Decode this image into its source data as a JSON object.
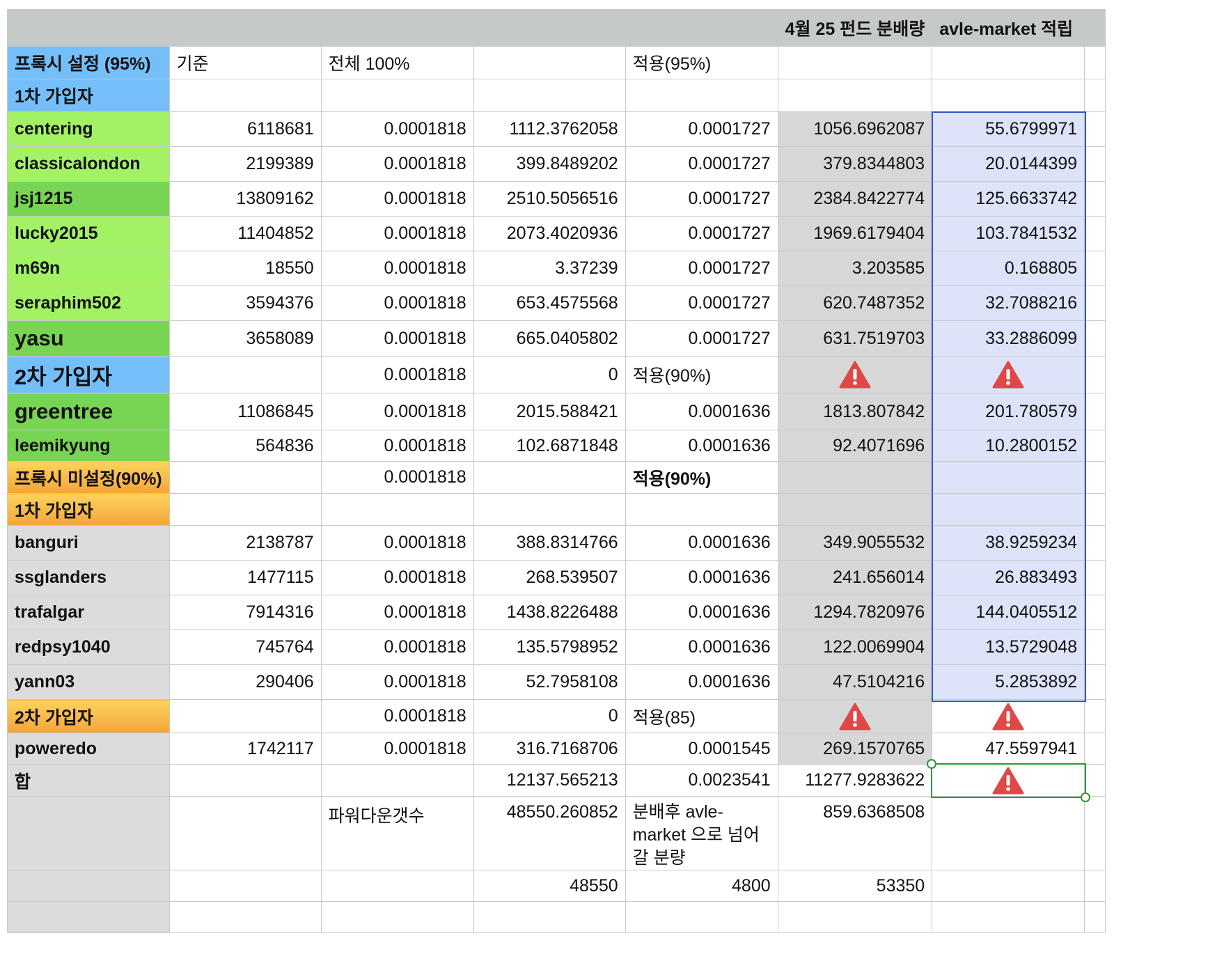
{
  "colors": {
    "header": "#c6c9c9",
    "blue_label": "#74bffa",
    "green_light": "#a3f264",
    "green_dark": "#78d554",
    "orange_label": "#f8b344",
    "gray_label": "#dcdcdc",
    "fund_col": "#d7d7d7",
    "selected_col": "#dde3f8",
    "warning": "#e04848"
  },
  "columns": [
    "",
    "",
    "",
    "",
    "",
    "4월 25 펀드 분배량",
    "avle-market 적립"
  ],
  "rows": [
    {
      "cells": [
        "프록시 설정 (95%)",
        "기준",
        "전체 100%",
        "",
        "적용(95%)",
        "",
        ""
      ]
    },
    {
      "cells": [
        "1차 가입자",
        "",
        "",
        "",
        "",
        "",
        ""
      ]
    },
    {
      "cells": [
        "centering",
        "6118681",
        "0.0001818",
        "1112.3762058",
        "0.0001727",
        "1056.6962087",
        "55.6799971"
      ]
    },
    {
      "cells": [
        "classicalondon",
        "2199389",
        "0.0001818",
        "399.8489202",
        "0.0001727",
        "379.8344803",
        "20.0144399"
      ]
    },
    {
      "cells": [
        "jsj1215",
        "13809162",
        "0.0001818",
        "2510.5056516",
        "0.0001727",
        "2384.8422774",
        "125.6633742"
      ]
    },
    {
      "cells": [
        "lucky2015",
        "11404852",
        "0.0001818",
        "2073.4020936",
        "0.0001727",
        "1969.6179404",
        "103.7841532"
      ]
    },
    {
      "cells": [
        "m69n",
        "18550",
        "0.0001818",
        "3.37239",
        "0.0001727",
        "3.203585",
        "0.168805"
      ]
    },
    {
      "cells": [
        "seraphim502",
        "3594376",
        "0.0001818",
        "653.4575568",
        "0.0001727",
        "620.7487352",
        "32.7088216"
      ]
    },
    {
      "cells": [
        "yasu",
        "3658089",
        "0.0001818",
        "665.0405802",
        "0.0001727",
        "631.7519703",
        "33.2886099"
      ]
    },
    {
      "cells": [
        "2차 가입자",
        "",
        "0.0001818",
        "0",
        "적용(90%)",
        "",
        ""
      ]
    },
    {
      "cells": [
        "greentree",
        "11086845",
        "0.0001818",
        "2015.588421",
        "0.0001636",
        "1813.807842",
        "201.780579"
      ]
    },
    {
      "cells": [
        "leemikyung",
        "564836",
        "0.0001818",
        "102.6871848",
        "0.0001636",
        "92.4071696",
        "10.2800152"
      ]
    },
    {
      "cells": [
        "프록시 미설정(90%)",
        "",
        "0.0001818",
        "",
        "적용(90%)",
        "",
        ""
      ]
    },
    {
      "cells": [
        "1차 가입자",
        "",
        "",
        "",
        "",
        "",
        ""
      ]
    },
    {
      "cells": [
        "banguri",
        "2138787",
        "0.0001818",
        "388.8314766",
        "0.0001636",
        "349.9055532",
        "38.9259234"
      ]
    },
    {
      "cells": [
        "ssglanders",
        "1477115",
        "0.0001818",
        "268.539507",
        "0.0001636",
        "241.656014",
        "26.883493"
      ]
    },
    {
      "cells": [
        "trafalgar",
        "7914316",
        "0.0001818",
        "1438.8226488",
        "0.0001636",
        "1294.7820976",
        "144.0405512"
      ]
    },
    {
      "cells": [
        "redpsy1040",
        "745764",
        "0.0001818",
        "135.5798952",
        "0.0001636",
        "122.0069904",
        "13.5729048"
      ]
    },
    {
      "cells": [
        "yann03",
        "290406",
        "0.0001818",
        "52.7958108",
        "0.0001636",
        "47.5104216",
        "5.2853892"
      ]
    },
    {
      "cells": [
        "2차 가입자",
        "",
        "0.0001818",
        "0",
        "적용(85)",
        "",
        ""
      ]
    },
    {
      "cells": [
        "poweredo",
        "1742117",
        "0.0001818",
        "316.7168706",
        "0.0001545",
        "269.1570765",
        "47.5597941"
      ]
    },
    {
      "cells": [
        "합",
        "",
        "",
        "12137.565213",
        "0.0023541",
        "11277.9283622",
        ""
      ]
    },
    {
      "cells": [
        "",
        "",
        "파워다운갯수",
        "48550.260852",
        "분배후 avle-market 으로 넘어갈 분량",
        "859.6368508",
        ""
      ]
    },
    {
      "cells": [
        "",
        "",
        "",
        "48550",
        "4800",
        "53350",
        ""
      ]
    },
    {
      "cells": [
        "",
        "",
        "",
        "",
        "",
        "",
        ""
      ]
    }
  ]
}
